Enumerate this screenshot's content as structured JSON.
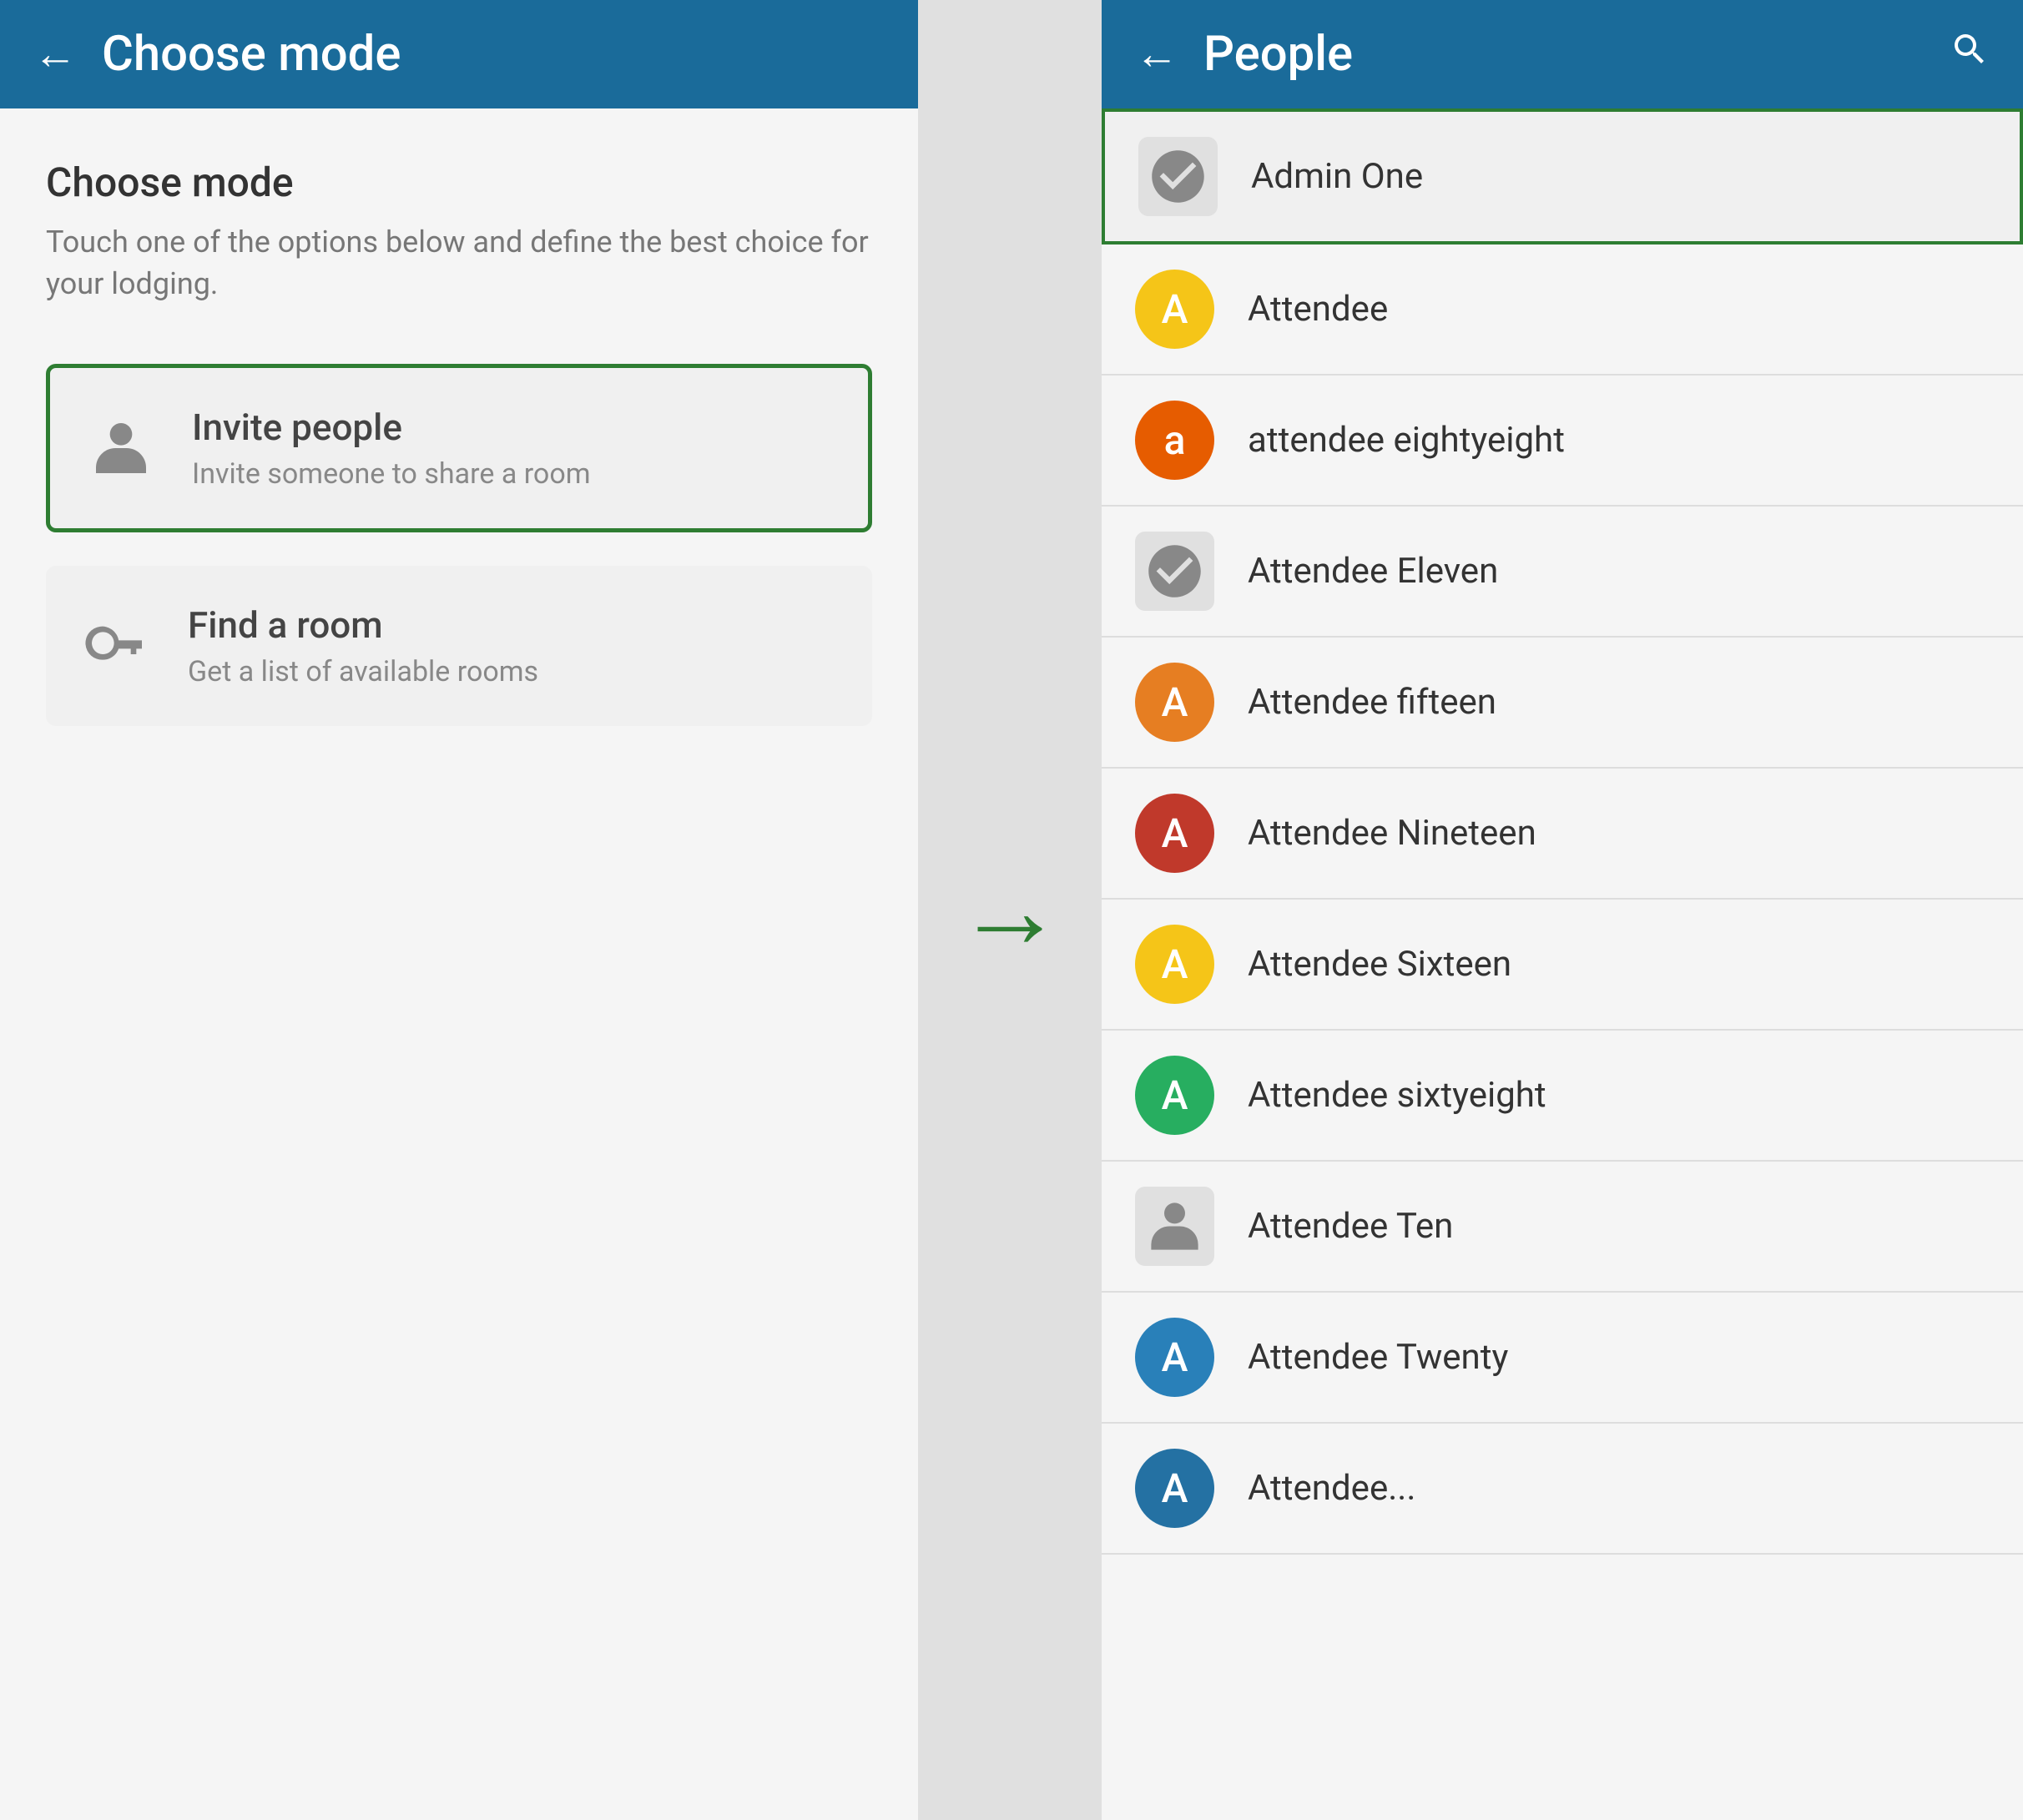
{
  "left": {
    "header": {
      "back_label": "←",
      "title": "Choose mode"
    },
    "page_title": "Choose mode",
    "page_subtitle": "Touch one of the options below and define the best choice for your lodging.",
    "options": [
      {
        "id": "invite",
        "title": "Invite people",
        "subtitle": "Invite someone to share a room",
        "selected": true,
        "icon_type": "person"
      },
      {
        "id": "find",
        "title": "Find a room",
        "subtitle": "Get a list of available rooms",
        "selected": false,
        "icon_type": "keys"
      }
    ]
  },
  "arrow": "→",
  "right": {
    "header": {
      "back_label": "←",
      "title": "People",
      "search_label": "🔍"
    },
    "people": [
      {
        "id": "admin-one",
        "name": "Admin One",
        "avatar_type": "image",
        "highlighted": true
      },
      {
        "id": "attendee",
        "name": "Attendee",
        "avatar_type": "circle",
        "avatar_letter": "A",
        "avatar_color": "bg-yellow",
        "highlighted": false
      },
      {
        "id": "attendee-eightyeight",
        "name": "attendee eightyeight",
        "avatar_type": "circle",
        "avatar_letter": "a",
        "avatar_color": "bg-orange",
        "highlighted": false
      },
      {
        "id": "attendee-eleven",
        "name": "Attendee Eleven",
        "avatar_type": "image",
        "avatar_color": "",
        "highlighted": false
      },
      {
        "id": "attendee-fifteen",
        "name": "Attendee fifteen",
        "avatar_type": "circle",
        "avatar_letter": "A",
        "avatar_color": "bg-orange2",
        "highlighted": false
      },
      {
        "id": "attendee-nineteen",
        "name": "Attendee Nineteen",
        "avatar_type": "circle",
        "avatar_letter": "A",
        "avatar_color": "bg-red",
        "highlighted": false
      },
      {
        "id": "attendee-sixteen",
        "name": "Attendee Sixteen",
        "avatar_type": "circle",
        "avatar_letter": "A",
        "avatar_color": "bg-yellow",
        "highlighted": false
      },
      {
        "id": "attendee-sixtyeight",
        "name": "Attendee sixtyeight",
        "avatar_type": "circle",
        "avatar_letter": "A",
        "avatar_color": "bg-teal",
        "highlighted": false
      },
      {
        "id": "attendee-ten",
        "name": "Attendee Ten",
        "avatar_type": "image2",
        "highlighted": false
      },
      {
        "id": "attendee-twenty",
        "name": "Attendee Twenty",
        "avatar_type": "circle",
        "avatar_letter": "A",
        "avatar_color": "bg-blue",
        "highlighted": false
      },
      {
        "id": "attendee-extra",
        "name": "Attendee...",
        "avatar_type": "circle",
        "avatar_letter": "A",
        "avatar_color": "bg-blue2",
        "highlighted": false,
        "partial": true
      }
    ]
  }
}
